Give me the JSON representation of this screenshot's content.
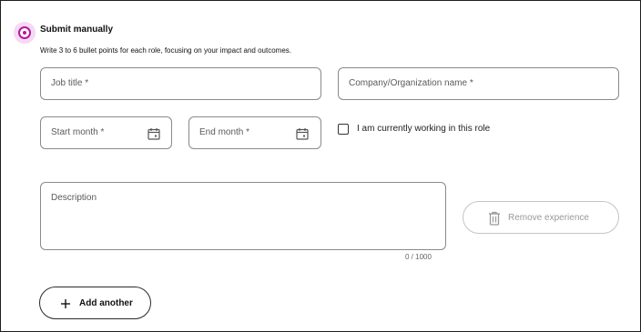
{
  "section": {
    "heading": "Submit manually",
    "subtext": "Write 3 to 6 bullet points for each role, focusing on your impact and outcomes.",
    "radio_selected": true,
    "accent_color": "#b5179e"
  },
  "form": {
    "job_title_placeholder": "Job title *",
    "company_placeholder": "Company/Organization name *",
    "start_month_placeholder": "Start month *",
    "end_month_placeholder": "End month *",
    "current_role_label": "I am currently working in this role",
    "current_role_checked": false,
    "description_placeholder": "Description",
    "description_counter": "0 / 1000"
  },
  "actions": {
    "remove_label": "Remove experience",
    "remove_icon": "trash-icon",
    "add_label": "Add another",
    "add_icon": "plus-icon"
  }
}
